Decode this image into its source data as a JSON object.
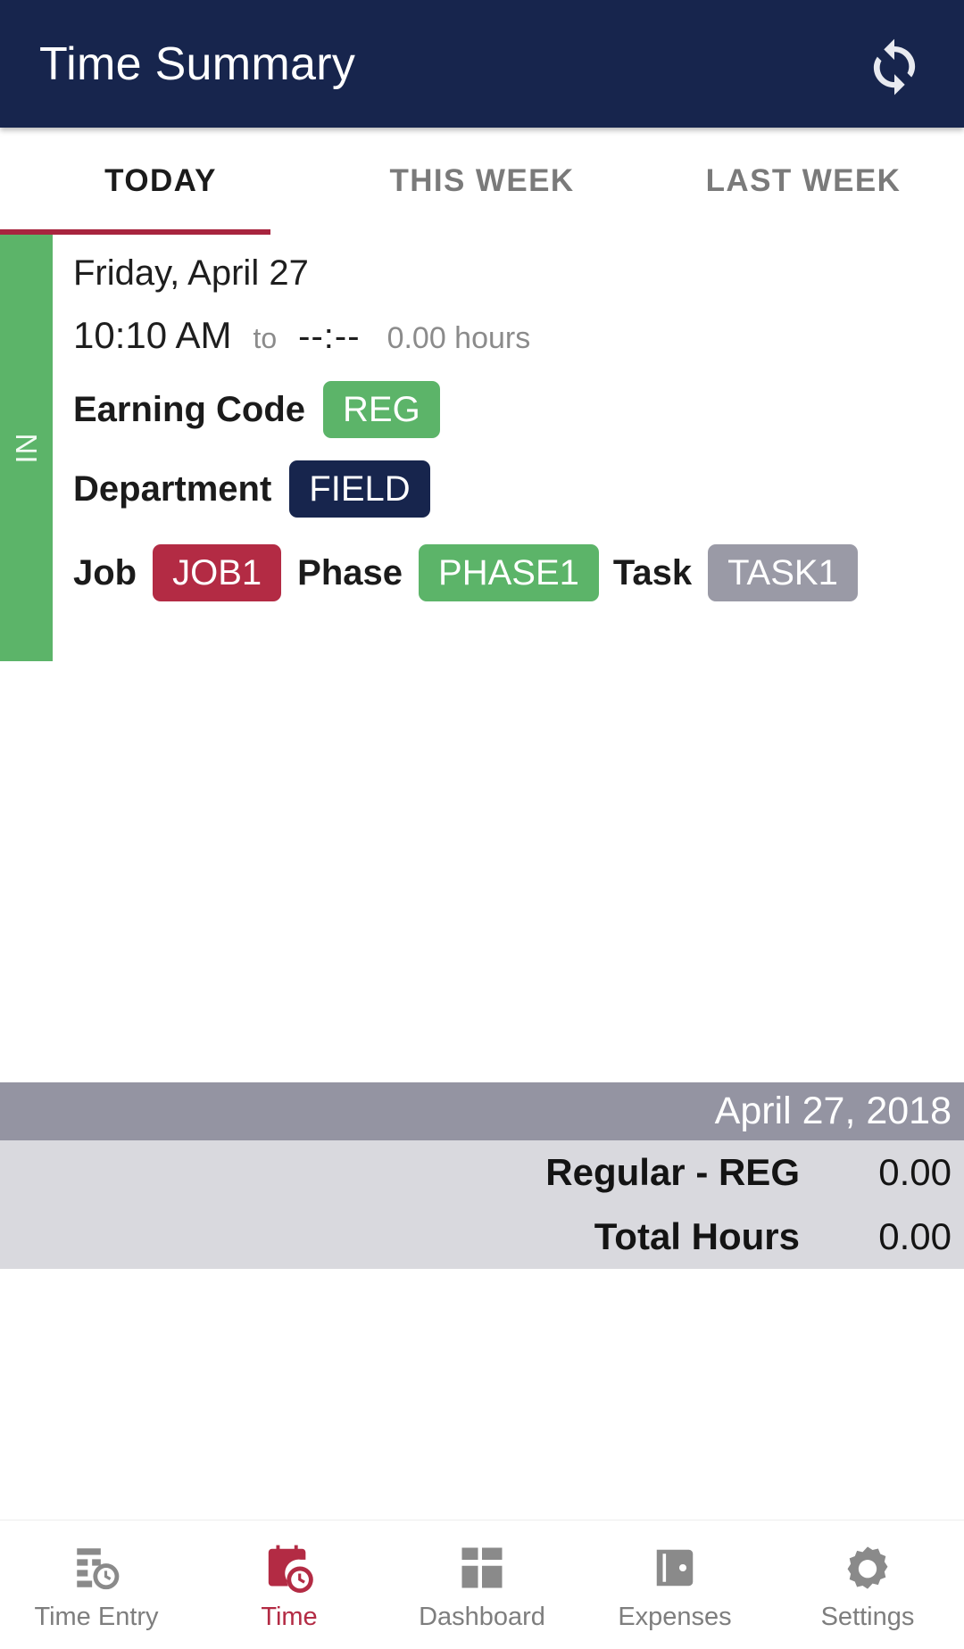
{
  "appbar": {
    "title": "Time Summary",
    "sync_icon": "sync-icon"
  },
  "tabs": {
    "items": [
      {
        "label": "TODAY",
        "active": true
      },
      {
        "label": "THIS WEEK",
        "active": false
      },
      {
        "label": "LAST WEEK",
        "active": false
      }
    ],
    "active_indicator_color": "#a8253f"
  },
  "entry": {
    "status_label": "IN",
    "status_color": "#5cb469",
    "date": "Friday, April 27",
    "start_time": "10:10 AM",
    "to_label": "to",
    "end_time": "--:--",
    "hours": "0.00 hours",
    "earning_code_label": "Earning Code",
    "earning_code_value": "REG",
    "earning_code_color": "#5cb469",
    "department_label": "Department",
    "department_value": "FIELD",
    "department_color": "#17254d",
    "job_label": "Job",
    "job_value": "JOB1",
    "job_color": "#b32b44",
    "phase_label": "Phase",
    "phase_value": "PHASE1",
    "phase_color": "#5cb469",
    "task_label": "Task",
    "task_value": "TASK1",
    "task_color": "#9a9aa6"
  },
  "summary": {
    "date": "April 27, 2018",
    "rows": [
      {
        "label": "Regular - REG",
        "value": "0.00"
      },
      {
        "label": "Total Hours",
        "value": "0.00"
      }
    ]
  },
  "bottom_nav": {
    "items": [
      {
        "label": "Time Entry",
        "icon": "time-entry-icon",
        "active": false
      },
      {
        "label": "Time",
        "icon": "time-clock-calendar-icon",
        "active": true
      },
      {
        "label": "Dashboard",
        "icon": "dashboard-grid-icon",
        "active": false
      },
      {
        "label": "Expenses",
        "icon": "wallet-icon",
        "active": false
      },
      {
        "label": "Settings",
        "icon": "gear-icon",
        "active": false
      }
    ],
    "active_color": "#b32b44",
    "inactive_color": "#8a8a8a"
  }
}
